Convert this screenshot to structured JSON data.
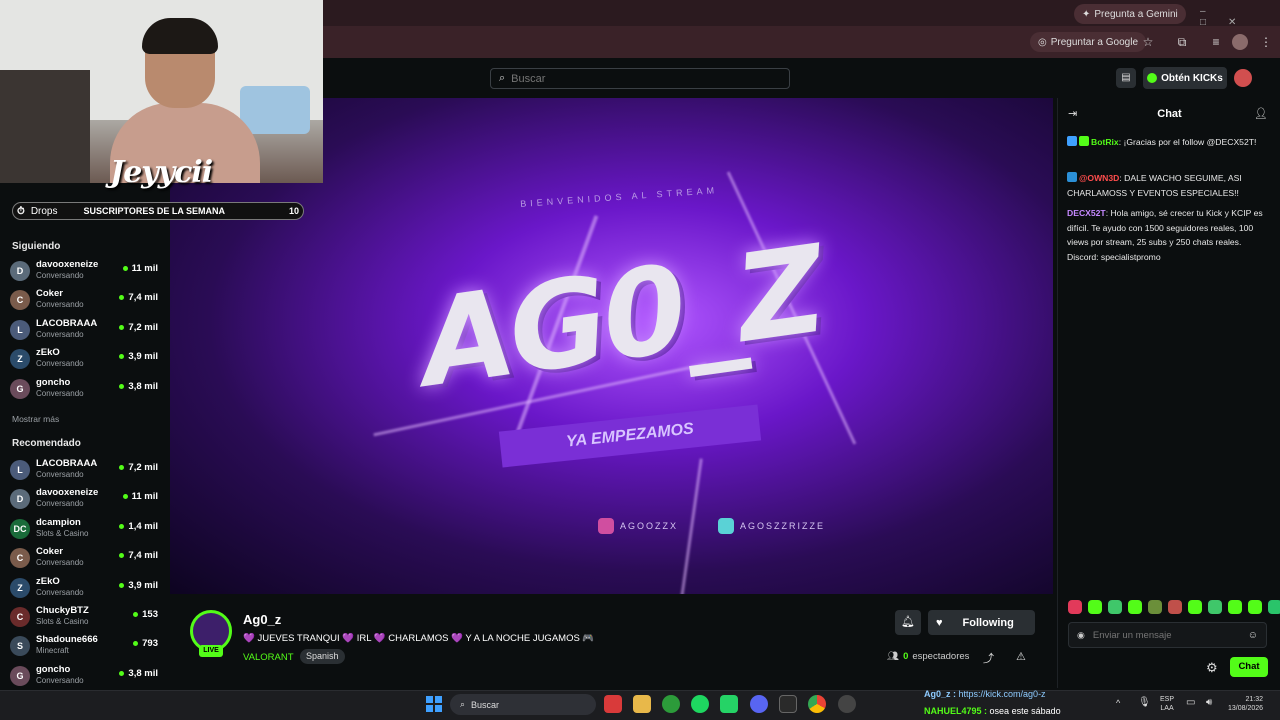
{
  "browser": {
    "gemini_pill": "Pregunta a Gemini",
    "google_pill": "Preguntar a Google"
  },
  "header": {
    "search_placeholder": "Buscar",
    "kicks_button": "Obtén KICKs"
  },
  "webcam": {
    "overlay_name": "Jeyycii"
  },
  "drops_bar": {
    "drops_label": "Drops",
    "banner_label": "SUSCRIPTORES DE LA SEMANA",
    "count": "10"
  },
  "sidebar": {
    "following_heading": "Siguiendo",
    "following": [
      {
        "name": "davooxeneize",
        "sub": "Conversando",
        "viewers": "11 mil",
        "initial": "D",
        "color": "#5b6b7a"
      },
      {
        "name": "Coker",
        "sub": "Conversando",
        "viewers": "7,4 mil",
        "initial": "C",
        "color": "#7a5b4b"
      },
      {
        "name": "LACOBRAAA",
        "sub": "Conversando",
        "viewers": "7,2 mil",
        "initial": "L",
        "color": "#4b5b7a"
      },
      {
        "name": "zEkO",
        "sub": "Conversando",
        "viewers": "3,9 mil",
        "initial": "Z",
        "color": "#2b4b6a"
      },
      {
        "name": "goncho",
        "sub": "Conversando",
        "viewers": "3,8 mil",
        "initial": "G",
        "color": "#6a4b5b"
      }
    ],
    "show_more": "Mostrar más",
    "recommended_heading": "Recomendado",
    "recommended": [
      {
        "name": "LACOBRAAA",
        "sub": "Conversando",
        "viewers": "7,2 mil",
        "initial": "L",
        "color": "#4b5b7a"
      },
      {
        "name": "davooxeneize",
        "sub": "Conversando",
        "viewers": "11 mil",
        "initial": "D",
        "color": "#5b6b7a"
      },
      {
        "name": "dcampion",
        "sub": "Slots & Casino",
        "viewers": "1,4 mil",
        "initial": "DC",
        "color": "#1a6b3a"
      },
      {
        "name": "Coker",
        "sub": "Conversando",
        "viewers": "7,4 mil",
        "initial": "C",
        "color": "#7a5b4b"
      },
      {
        "name": "zEkO",
        "sub": "Conversando",
        "viewers": "3,9 mil",
        "initial": "Z",
        "color": "#2b4b6a"
      },
      {
        "name": "ChuckyBTZ",
        "sub": "Slots & Casino",
        "viewers": "153",
        "initial": "C",
        "color": "#6a2b2b"
      },
      {
        "name": "Shadoune666",
        "sub": "Minecraft",
        "viewers": "793",
        "initial": "S",
        "color": "#3a4a5a"
      },
      {
        "name": "goncho",
        "sub": "Conversando",
        "viewers": "3,8 mil",
        "initial": "G",
        "color": "#6a4b5b"
      }
    ]
  },
  "video": {
    "logo_text": "AG0_Z",
    "sub_text": "YA EMPEZAMOS",
    "welcome_text": "BIENVENIDOS AL STREAM",
    "instagram": "AGOOZZX",
    "tiktok": "AGOSZZRIZZE"
  },
  "stream": {
    "streamer_name": "Ag0_z",
    "live_label": "LIVE",
    "title": "💜 JUEVES TRANQUI 💜 IRL 💜 CHARLAMOS 💜 Y A LA NOCHE JUGAMOS 🎮",
    "game": "VALORANT",
    "language": "Spanish",
    "follow_label": "Following",
    "viewer_count": "0",
    "viewer_label": "espectadores"
  },
  "chat": {
    "title": "Chat",
    "messages": [
      {
        "user": "BotRix",
        "color": "#53fc18",
        "text": "¡Gracias por el follow @DECX52T!"
      },
      {
        "user": "@OWN3D",
        "color": "#ff4d4d",
        "text": "DALE WACHO SEGUIME, ASI CHARLAMOSS Y EVENTOS ESPECIALES!!"
      },
      {
        "user": "DECX52T",
        "color": "#c589ff",
        "text": "Hola amigo, sé crecer tu Kick y KCIP es difícil. Te ayudo con 1500 seguidores reales, 100 views por stream, 25 subs y 250 chats reales. Discord: specialistpromo"
      }
    ],
    "input_placeholder": "Enviar un mensaje",
    "send_label": "Chat"
  },
  "taskbar": {
    "search_label": "Buscar",
    "notif_line1_user": "Ag0_z :",
    "notif_line1_text": "https://kick.com/ag0-z",
    "notif_line2_user": "NAHUEL4795 :",
    "notif_line2_text": "osea este sábado",
    "lang_top": "ESP",
    "lang_bottom": "LAA",
    "time": "21:32",
    "date": "13/08/2026"
  },
  "colors": {
    "kick_green": "#53fc18",
    "background": "#0b0e0f"
  }
}
